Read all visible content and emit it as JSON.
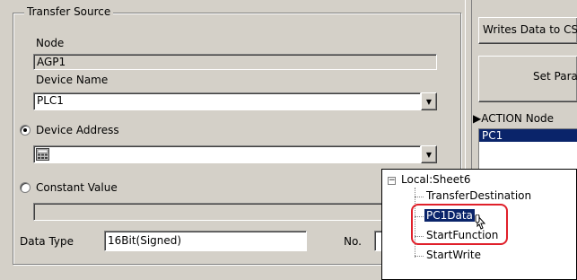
{
  "transfer_source": {
    "title": "Transfer Source",
    "node_label": "Node",
    "node_value": "AGP1",
    "device_name_label": "Device Name",
    "device_name_value": "PLC1",
    "device_address_label": "Device Address",
    "device_address_value": "",
    "constant_value_label": "Constant Value",
    "constant_value_value": "",
    "data_type_label": "Data Type",
    "data_type_value": "16Bit(Signed)",
    "no_label": "No."
  },
  "right_panel": {
    "writes_button": "Writes Data to CS",
    "set_button": "Set Para",
    "action_node_label": "▶ACTION Node",
    "action_nodes": [
      "PC1"
    ]
  },
  "tree": {
    "root": "Local:Sheet6",
    "expander": "−",
    "children": [
      "TransferDestination",
      "PC1Data",
      "StartFunction",
      "StartWrite"
    ],
    "selected": "PC1Data"
  },
  "colors": {
    "selection": "#0a246a",
    "highlight": "#e0202a",
    "window_bg": "#d4d0c8"
  }
}
